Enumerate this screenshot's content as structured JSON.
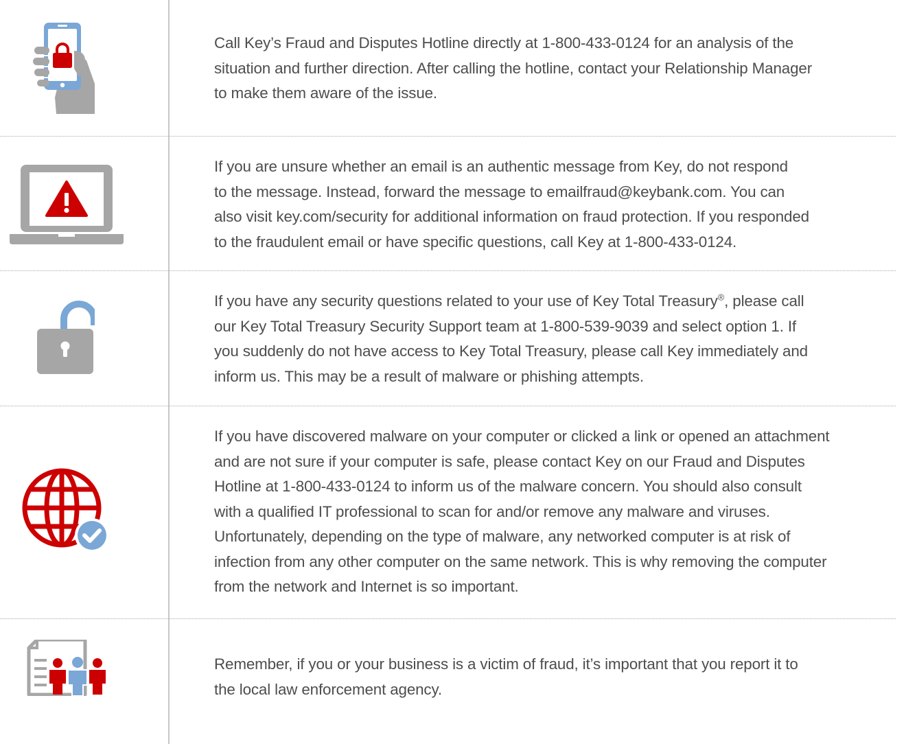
{
  "colors": {
    "text": "#4d4d4d",
    "accent_red": "#cc0000",
    "icon_grey": "#a6a6a6",
    "icon_blue": "#7aa7d6",
    "divider": "#c8c8c8"
  },
  "items": [
    {
      "icon": "mobile-phone-lock-icon",
      "lines": [
        "Call Key’s Fraud and Disputes Hotline directly at 1-800-433-0124 for an analysis of the",
        "situation and further direction. After calling the hotline, contact your Relationship Manager",
        "to make them aware of the issue."
      ]
    },
    {
      "icon": "laptop-warning-icon",
      "lines": [
        "If you are unsure whether an email is an authentic message from Key, do not respond",
        "to the message. Instead, forward the message to emailfraud@keybank.com. You can",
        "also visit key.com/security for additional information on fraud protection. If you responded",
        "to the fraudulent email or have specific questions, call Key at 1-800-433-0124."
      ]
    },
    {
      "icon": "unlocked-padlock-icon",
      "line1_before": "If you have any security questions related to your use of Key Total Treasury",
      "registered_mark": "®",
      "line1_after": ", please call",
      "lines": [
        "our Key Total Treasury Security Support team at 1-800-539-9039 and select option 1. If",
        "you suddenly do not have access to Key Total Treasury, please call Key immediately and",
        "inform us. This may be a result of malware or phishing attempts."
      ]
    },
    {
      "icon": "globe-checkmark-icon",
      "lines": [
        "If you have discovered malware on your computer or clicked a link or opened an attachment",
        "and are not sure if your computer is safe, please contact Key on our Fraud and Disputes",
        "Hotline at 1-800-433-0124 to inform us of the malware concern. You should also consult",
        "with a qualified IT professional to scan for and/or remove any malware and viruses.",
        "Unfortunately, depending on the type of malware, any networked computer is at risk of",
        "infection from any other computer on the same network. This is why removing the computer",
        "from the network and Internet is so important."
      ]
    },
    {
      "icon": "document-people-icon",
      "lines": [
        "Remember, if you or your business is a victim of fraud, it’s important that you report it to",
        "the local law enforcement agency."
      ]
    }
  ]
}
